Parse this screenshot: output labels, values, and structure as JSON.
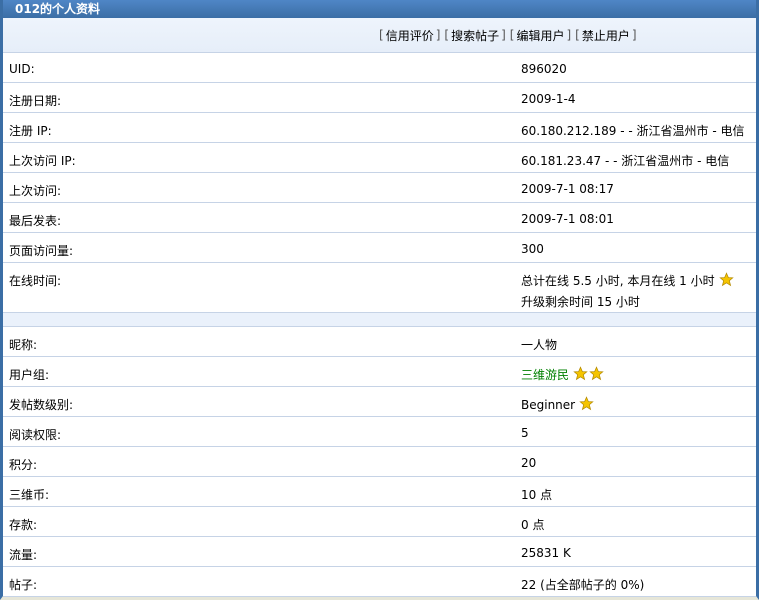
{
  "header": {
    "title": "012的个人资料"
  },
  "actions": [
    {
      "label": "信用评价"
    },
    {
      "label": "搜索帖子"
    },
    {
      "label": "编辑用户"
    },
    {
      "label": "禁止用户"
    }
  ],
  "rows": {
    "uid": {
      "label": "UID:",
      "value": "896020"
    },
    "reg_date": {
      "label": "注册日期:",
      "value": "2009-1-4"
    },
    "reg_ip": {
      "label": "注册  IP:",
      "value": "60.180.212.189 - - 浙江省温州市  - 电信"
    },
    "last_ip": {
      "label": "上次访问  IP:",
      "value": "60.181.23.47 - - 浙江省温州市  - 电信"
    },
    "last_visit": {
      "label": "上次访问:",
      "value": "2009-7-1 08:17"
    },
    "last_post": {
      "label": "最后发表:",
      "value": "2009-7-1 08:01"
    },
    "page_views": {
      "label": "页面访问量:",
      "value": "300"
    },
    "online_time": {
      "label": "在线时间:",
      "line1": "总计在线  5.5 小时, 本月在线  1 小时",
      "line2": "升级剩余时间  15 小时"
    },
    "nickname": {
      "label": "昵称:",
      "value": "一人物"
    },
    "user_group": {
      "label": "用户组:",
      "value": "三维游民"
    },
    "post_level": {
      "label": "发帖数级别:",
      "value": "Beginner"
    },
    "read_perm": {
      "label": "阅读权限:",
      "value": "5"
    },
    "points": {
      "label": "积分:",
      "value": "20"
    },
    "coins": {
      "label": "三维币:",
      "value": "10 点"
    },
    "deposit": {
      "label": "存款:",
      "value": "0 点"
    },
    "traffic": {
      "label": "流量:",
      "value": "25831 K"
    },
    "posts": {
      "label": "帖子:",
      "value": "22 (占全部帖子的  0%)"
    }
  },
  "colors": {
    "header": "#3b6ea5",
    "group_text": "#008000",
    "star": "#f5c400"
  }
}
